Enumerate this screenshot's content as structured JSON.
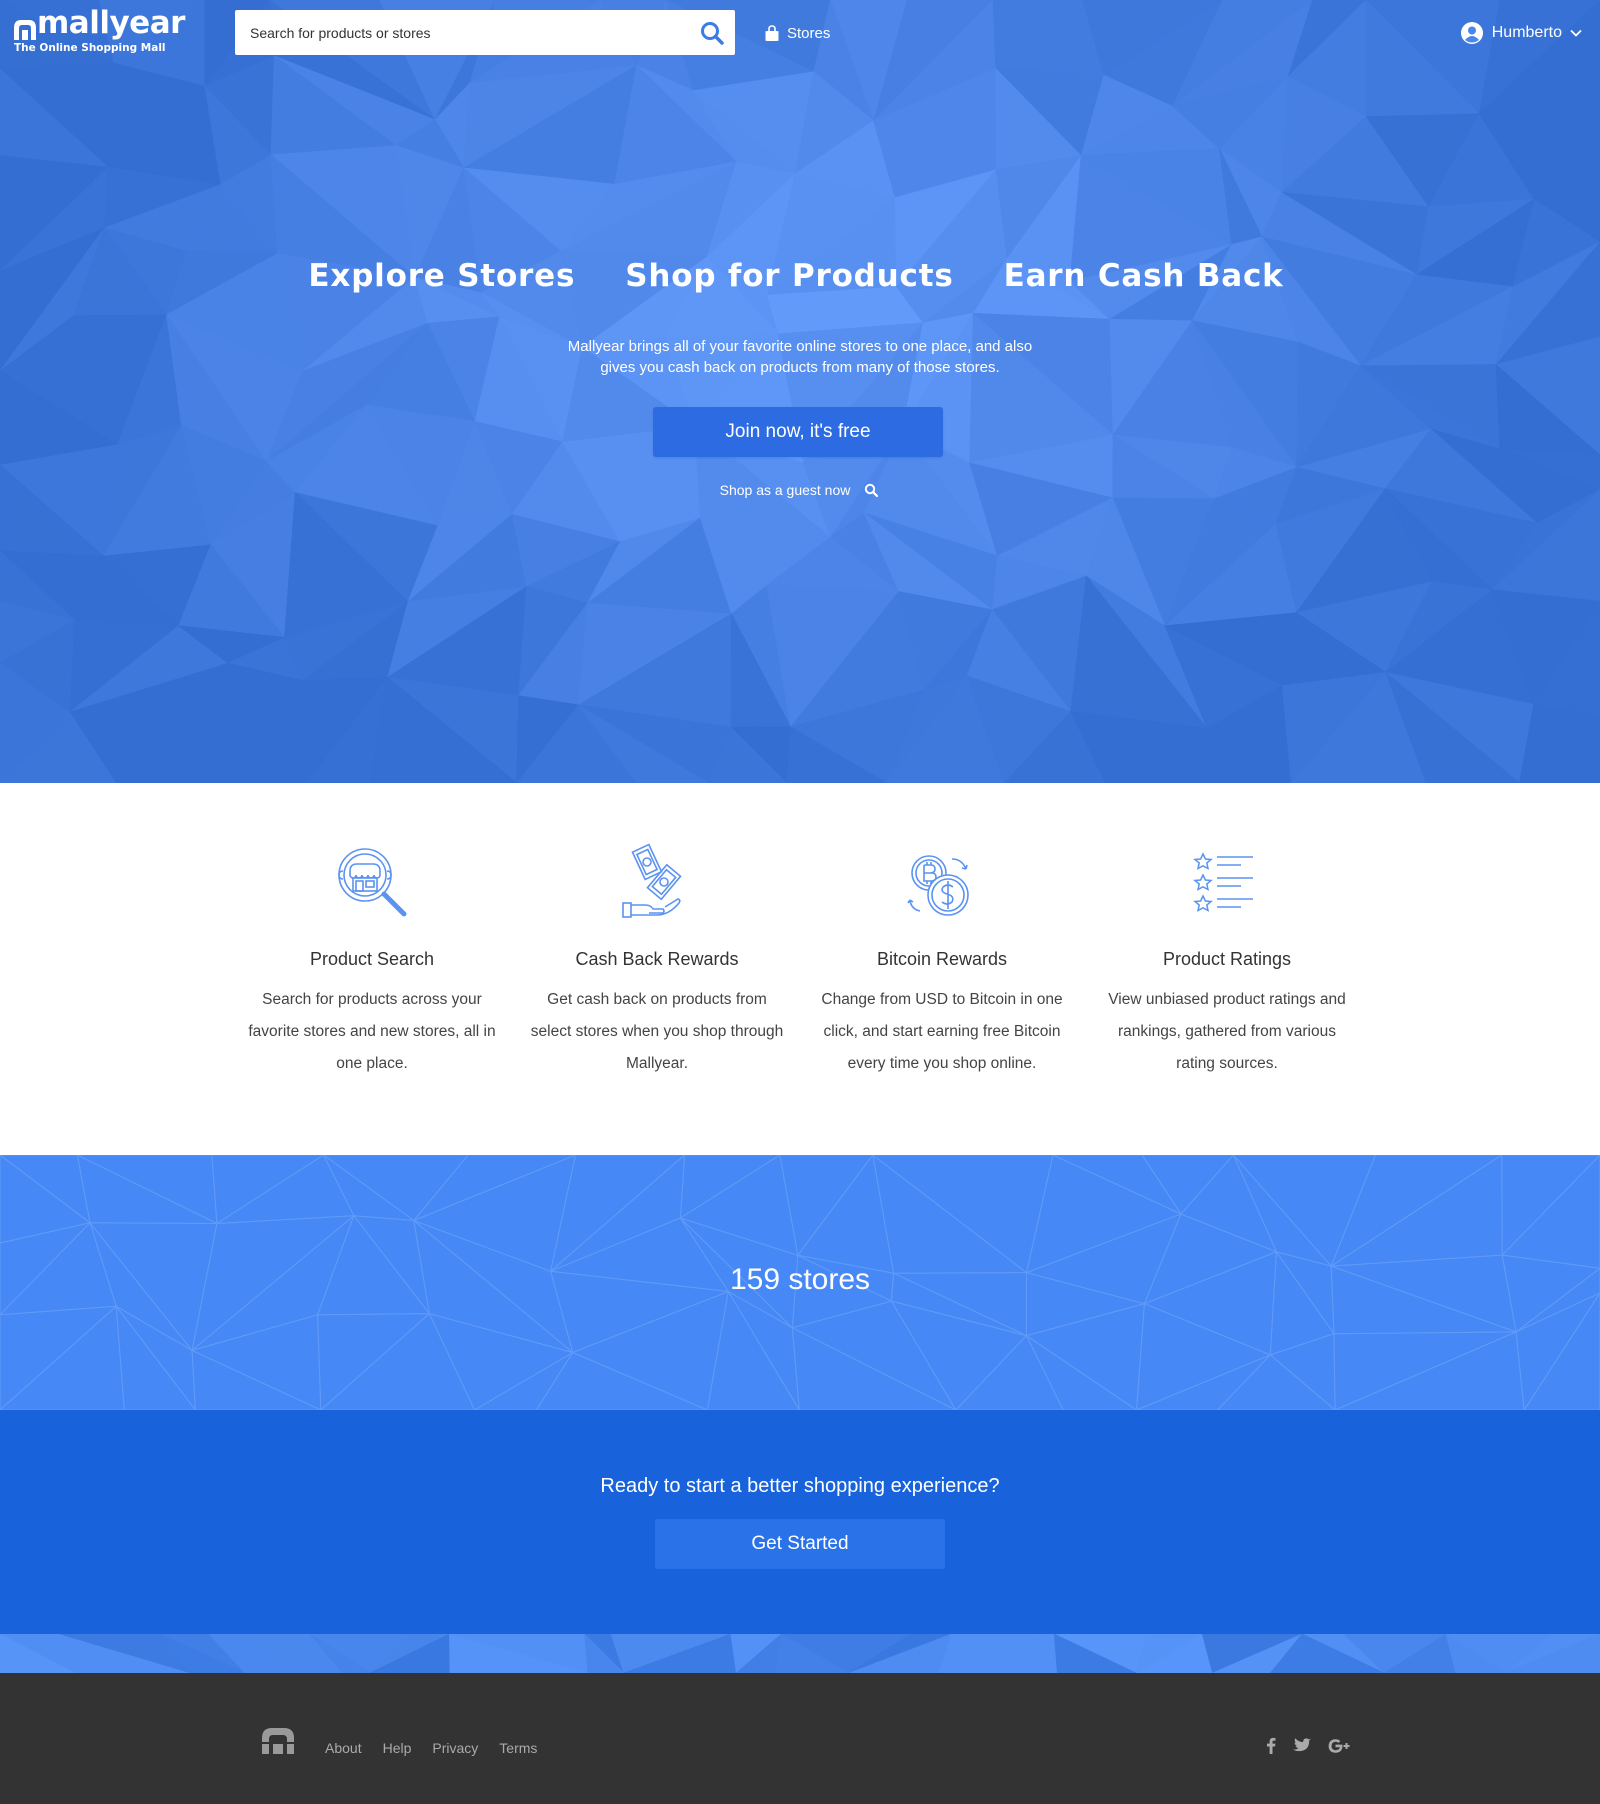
{
  "brand": {
    "name": "mallyear",
    "tagline": "The Online Shopping Mall"
  },
  "nav": {
    "search_placeholder": "Search for products or stores",
    "stores_label": "Stores",
    "user_name": "Humberto"
  },
  "hero": {
    "headlines": [
      "Explore Stores",
      "Shop for Products",
      "Earn Cash Back"
    ],
    "description": "Mallyear brings all of your favorite online stores to one place, and also gives you cash back on products from many of those stores.",
    "join_label": "Join now, it's free",
    "guest_label": "Shop as a guest now"
  },
  "features": [
    {
      "icon": "store-search-icon",
      "title": "Product Search",
      "description": "Search for products across your favorite stores and new stores, all in one place."
    },
    {
      "icon": "cash-hand-icon",
      "title": "Cash Back Rewards",
      "description": "Get cash back on products from select stores when you shop through Mallyear."
    },
    {
      "icon": "bitcoin-exchange-icon",
      "title": "Bitcoin Rewards",
      "description": "Change from USD to Bitcoin in one click, and start earning free Bitcoin every time you shop online."
    },
    {
      "icon": "star-list-icon",
      "title": "Product Ratings",
      "description": "View unbiased product ratings and rankings, gathered from various rating sources."
    }
  ],
  "stores_band": {
    "count_text": "159 stores"
  },
  "cta": {
    "text": "Ready to start a better shopping experience?",
    "button_label": "Get Started"
  },
  "footer": {
    "links": [
      "About",
      "Help",
      "Privacy",
      "Terms"
    ],
    "socials": [
      "facebook-icon",
      "twitter-icon",
      "google-plus-icon"
    ]
  },
  "colors": {
    "hero_blue": "#4a86ee",
    "button_blue": "#2d6be2",
    "cta_blue": "#1863db",
    "stores_blue": "#4588f6",
    "footer_dark": "#333333",
    "icon_blue": "#5b93f0"
  }
}
